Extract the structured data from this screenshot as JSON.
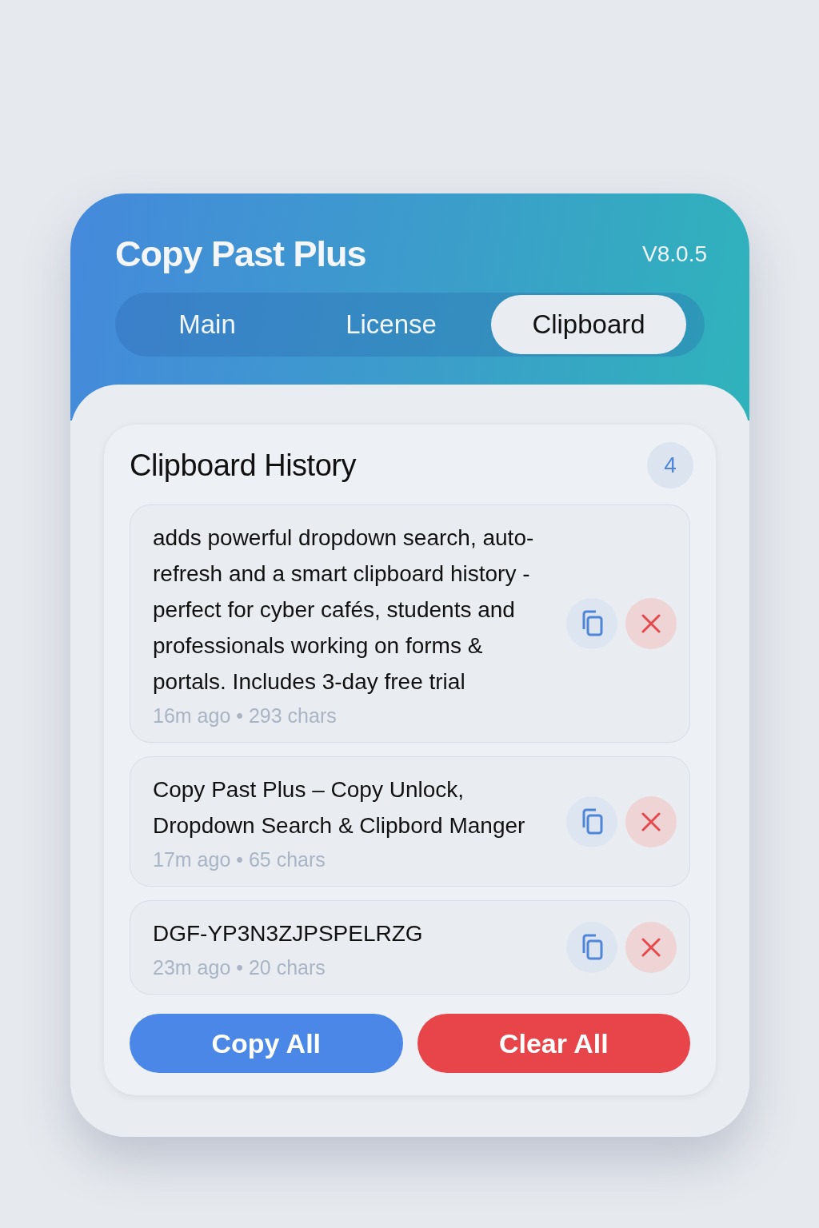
{
  "app": {
    "title": "Copy Past Plus",
    "version": "V8.0.5"
  },
  "tabs": [
    {
      "label": "Main",
      "selected": false
    },
    {
      "label": "License",
      "selected": false
    },
    {
      "label": "Clipboard",
      "selected": true
    }
  ],
  "history": {
    "title": "Clipboard History",
    "count": "4",
    "items": [
      {
        "text": "adds powerful dropdown search, auto-refresh and a smart clipboard history - perfect for cyber cafés, students and professionals working on forms & portals. Includes 3-day free trial",
        "meta": "16m ago • 293 chars"
      },
      {
        "text": "Copy Past Plus – Copy Unlock, Dropdown Search & Clipbord Manger",
        "meta": "17m ago • 65 chars"
      },
      {
        "text": "DGF-YP3N3ZJPSPELRZG",
        "meta": "23m ago • 20 chars"
      }
    ]
  },
  "actions": [
    {
      "label": "Copy All",
      "kind": "primary"
    },
    {
      "label": "Clear All",
      "kind": "danger"
    }
  ]
}
